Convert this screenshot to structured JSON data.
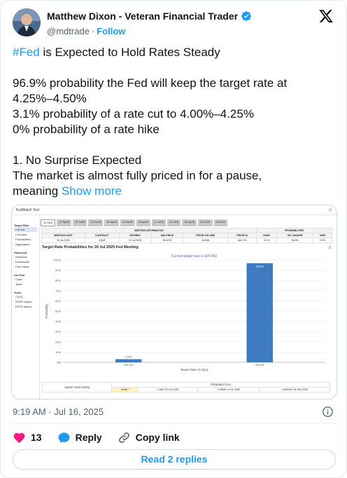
{
  "author": {
    "name": "Matthew Dixon - Veteran Financial Trader",
    "handle": "@mdtrade",
    "separator": "·",
    "follow_label": "Follow"
  },
  "tweet": {
    "hashtag": "#Fed",
    "title_rest": " is Expected to Hold Rates Steady",
    "lines": [
      "96.9% probability the Fed will keep the target rate at",
      "4.25%–4.50%",
      "3.1% probability of a rate cut to 4.00%–4.25%",
      "0% probability of a rate hike"
    ],
    "lines2": [
      "1. No Surprise Expected",
      "The market is almost fully priced in for a pause,"
    ],
    "last_line_prefix": "meaning ",
    "show_more": "Show more"
  },
  "media": {
    "app_title": "FedWatch Tool",
    "close_glyph": "✕",
    "sidebar": {
      "sections": [
        {
          "title": "Target Rate",
          "items": [
            "Current",
            "Compare",
            "Probabilities",
            "Aggregated"
          ]
        },
        {
          "title": "Historical",
          "items": [
            "Historical",
            "Downloads",
            "Prior Hikes"
          ]
        },
        {
          "title": "Dot Plot",
          "items": [
            "Chart",
            "Table"
          ]
        },
        {
          "title": "Tools",
          "items": [
            "CVOL",
            "SOFR Watch",
            "ESTR Watch"
          ]
        }
      ]
    },
    "tabs": [
      "30 Jul25",
      "17 Sep25",
      "29 Oct25",
      "10 Dec25",
      "28 Jan26",
      "18 Mar26",
      "29 Apr26",
      "17 Jun26",
      "29 Jul26",
      "16 Sep26",
      "28 Oct26",
      "9 Dec26"
    ],
    "table": {
      "group_meeting": "MEETING INFORMATION",
      "group_prob": "PROBABILITIES",
      "headers": [
        "MEETING DATE",
        "CONTRACT",
        "EXPIRES",
        "MID PRICE",
        "PRIOR VOLUME",
        "PRIOR OI",
        "EASE",
        "NO CHANGE",
        "HIKE"
      ],
      "row": [
        "30 Jul 2025",
        "ZQN5",
        "31 Jul 2025",
        "95.6700",
        "46,838",
        "484,793",
        "3.1%",
        "96.9%",
        "0.0%"
      ]
    },
    "chart_title": "Target Rate Probabilities for 30 Jul 2025 Fed Meeting",
    "menu_glyph": "≡",
    "bottom": {
      "target_rates_label": "TARGET RATES (BPS)",
      "probability_label": "PROBABILITY(%)",
      "now_label": "NOW *",
      "columns": [
        "1 DAY\n15 JUL 2025",
        "1 WEEK\n9 JUL 2025",
        "1 MONTH\n16 JUN 2025"
      ]
    }
  },
  "chart_data": {
    "type": "bar",
    "title": "Current target rate is 425-450",
    "xlabel": "Target Rate (in bps)",
    "ylabel": "Probability",
    "categories": [
      "400-425",
      "425-450"
    ],
    "values": [
      3.1,
      96.9
    ],
    "data_labels": [
      "3.1%",
      "96.9%"
    ],
    "yticks": [
      "0%",
      "10%",
      "20%",
      "30%",
      "40%",
      "50%",
      "60%",
      "70%",
      "80%",
      "90%",
      "100%"
    ],
    "ylim": [
      0,
      100
    ],
    "grid": true,
    "bar_color": "#3f7cbf"
  },
  "footer": {
    "timestamp": "9:19 AM · Jul 16, 2025",
    "likes": "13",
    "reply_label": "Reply",
    "copy_label": "Copy link",
    "read_replies": "Read 2 replies"
  },
  "colors": {
    "accent": "#1d9bf0",
    "like": "#f91880",
    "text": "#0f1419",
    "muted": "#536471"
  }
}
